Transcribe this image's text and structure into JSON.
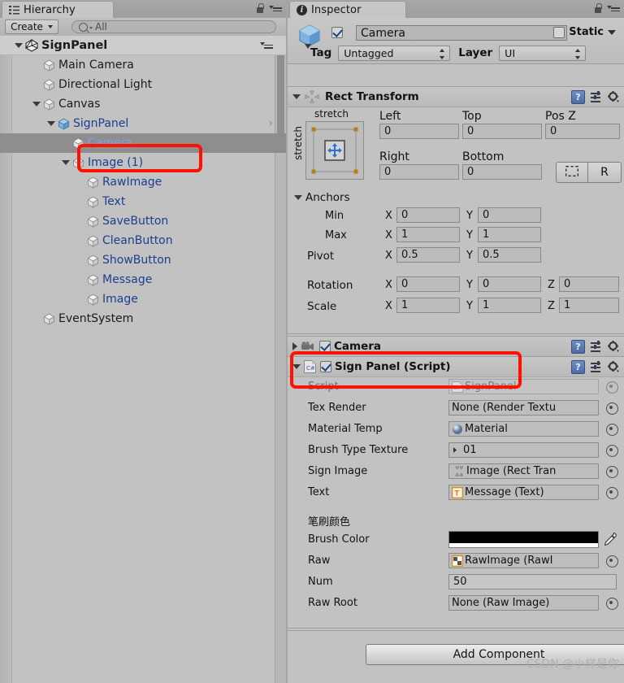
{
  "hierarchy": {
    "tab_label": "Hierarchy",
    "tab_icon": "hierarchy-icon",
    "lock_icon": "lock-icon",
    "menu_icon": "panel-menu-icon",
    "create_label": "Create",
    "search_placeholder": "All",
    "search_value": "All",
    "root": {
      "label": "SignPanel",
      "icon": "unity-logo-icon"
    },
    "items": [
      {
        "label": "Main Camera",
        "depth": 2,
        "color": "dark",
        "expander": "none"
      },
      {
        "label": "Directional Light",
        "depth": 2,
        "color": "dark",
        "expander": "none"
      },
      {
        "label": "Canvas",
        "depth": 2,
        "color": "dark",
        "expander": "open"
      },
      {
        "label": "SignPanel",
        "depth": 3,
        "color": "blue",
        "expander": "open",
        "prefab": true
      },
      {
        "label": "Camera",
        "depth": 4,
        "color": "lightblue",
        "expander": "none",
        "selected": true
      },
      {
        "label": "Image (1)",
        "depth": 4,
        "color": "blue",
        "expander": "open"
      },
      {
        "label": "RawImage",
        "depth": 5,
        "color": "blue",
        "expander": "none"
      },
      {
        "label": "Text",
        "depth": 5,
        "color": "blue",
        "expander": "none"
      },
      {
        "label": "SaveButton",
        "depth": 5,
        "color": "blue",
        "expander": "none"
      },
      {
        "label": "CleanButton",
        "depth": 5,
        "color": "blue",
        "expander": "none"
      },
      {
        "label": "ShowButton",
        "depth": 5,
        "color": "blue",
        "expander": "none"
      },
      {
        "label": "Message",
        "depth": 5,
        "color": "blue",
        "expander": "none"
      },
      {
        "label": "Image",
        "depth": 5,
        "color": "blue",
        "expander": "none"
      },
      {
        "label": "EventSystem",
        "depth": 2,
        "color": "dark",
        "expander": "none"
      }
    ]
  },
  "inspector": {
    "tab_label": "Inspector",
    "tab_icon": "info-icon",
    "lock_icon": "lock-icon",
    "menu_icon": "panel-menu-icon",
    "object_name": "Camera",
    "enabled": true,
    "static_label": "Static",
    "static_checked": false,
    "tag_label": "Tag",
    "tag_value": "Untagged",
    "layer_label": "Layer",
    "layer_value": "UI",
    "rect_transform": {
      "title": "Rect Transform",
      "anchor_preset_top": "stretch",
      "anchor_preset_left": "stretch",
      "left_label": "Left",
      "left_value": "0",
      "top_label": "Top",
      "top_value": "0",
      "posz_label": "Pos Z",
      "posz_value": "0",
      "right_label": "Right",
      "right_value": "0",
      "bottom_label": "Bottom",
      "bottom_value": "0",
      "raw_button": "R",
      "blueprint_button": "blueprint-icon",
      "anchors_label": "Anchors",
      "min_label": "Min",
      "min_x": "0",
      "min_y": "0",
      "max_label": "Max",
      "max_x": "1",
      "max_y": "1",
      "pivot_label": "Pivot",
      "pivot_x": "0.5",
      "pivot_y": "0.5",
      "rotation_label": "Rotation",
      "rot_x": "0",
      "rot_y": "0",
      "rot_z": "0",
      "scale_label": "Scale",
      "scale_x": "1",
      "scale_y": "1",
      "scale_z": "1",
      "axis_x": "X",
      "axis_y": "Y",
      "axis_z": "Z"
    },
    "camera_component": {
      "title": "Camera",
      "enabled": true,
      "collapsed": true
    },
    "sign_panel": {
      "title": "Sign Panel (Script)",
      "enabled": true,
      "fields": [
        {
          "label": "Script",
          "value": "SignPanel",
          "type": "object-readonly",
          "icon": "cs-script-icon"
        },
        {
          "label": "Tex Render",
          "value": "None (Render Textu",
          "type": "object",
          "icon": "none"
        },
        {
          "label": "Material Temp",
          "value": "Material",
          "type": "object",
          "icon": "material-sphere-icon"
        },
        {
          "label": "Brush Type Texture",
          "value": "01",
          "type": "object",
          "icon": "texture-icon"
        },
        {
          "label": "Sign Image",
          "value": "Image (Rect Tran",
          "type": "object",
          "icon": "rect-transform-icon"
        },
        {
          "label": "Text",
          "value": "Message (Text)",
          "type": "object",
          "icon": "text-icon"
        }
      ],
      "group_header": "笔刷颜色",
      "brush_color_label": "Brush Color",
      "brush_color_hex": "#000000",
      "eyedropper_icon": "eyedropper-icon",
      "fields2": [
        {
          "label": "Raw",
          "value": "RawImage (RawI",
          "type": "object",
          "icon": "rawimage-icon"
        },
        {
          "label": "Num",
          "value": "50",
          "type": "number",
          "icon": "none"
        },
        {
          "label": "Raw Root",
          "value": "None (Raw Image)",
          "type": "object",
          "icon": "none"
        }
      ]
    },
    "add_component_label": "Add Component"
  },
  "annotations": {
    "highlight_color": "#ff1000",
    "boxes": [
      "camera-hierarchy-row",
      "sign-panel-script-header"
    ]
  },
  "watermark": "CSDN @小样是你"
}
